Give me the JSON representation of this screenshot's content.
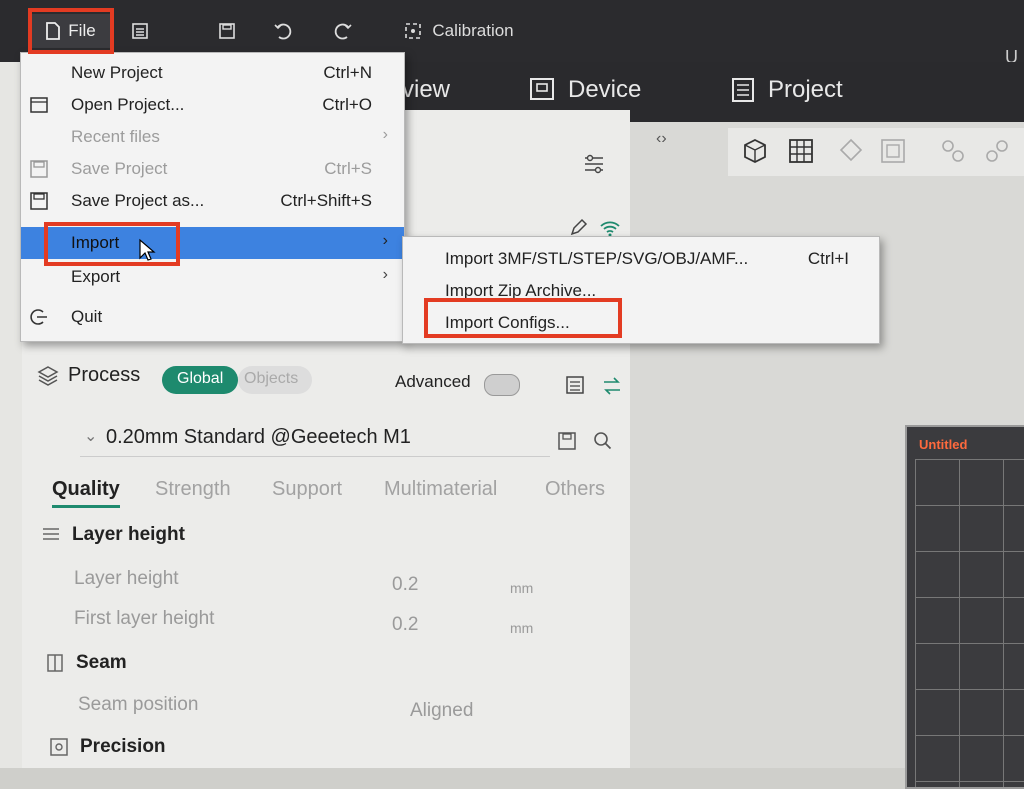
{
  "titlebar": {
    "file_label": "File",
    "calibration_label": "Calibration",
    "user_initial": "U"
  },
  "nav": {
    "tabs": [
      {
        "label": "view",
        "icon": "preview-icon"
      },
      {
        "label": "Device",
        "icon": "device-icon"
      },
      {
        "label": "Project",
        "icon": "project-icon"
      }
    ]
  },
  "file_menu": {
    "items": [
      {
        "label": "New Project",
        "shortcut": "Ctrl+N",
        "enabled": true
      },
      {
        "label": "Open Project...",
        "shortcut": "Ctrl+O",
        "enabled": true
      },
      {
        "label": "Recent files",
        "shortcut": "",
        "enabled": false,
        "submenu": true
      },
      {
        "label": "Save Project",
        "shortcut": "Ctrl+S",
        "enabled": false
      },
      {
        "label": "Save Project as...",
        "shortcut": "Ctrl+Shift+S",
        "enabled": true
      },
      {
        "label": "Import",
        "shortcut": "",
        "enabled": true,
        "submenu": true,
        "highlighted": true
      },
      {
        "label": "Export",
        "shortcut": "",
        "enabled": true,
        "submenu": true
      },
      {
        "label": "Quit",
        "shortcut": "",
        "enabled": true
      }
    ]
  },
  "import_submenu": {
    "items": [
      {
        "label": "Import 3MF/STL/STEP/SVG/OBJ/AMF...",
        "shortcut": "Ctrl+I"
      },
      {
        "label": "Import Zip Archive...",
        "shortcut": ""
      },
      {
        "label": "Import Configs...",
        "shortcut": ""
      }
    ]
  },
  "process": {
    "title": "Process",
    "toggle_global": "Global",
    "toggle_objects": "Objects",
    "advanced_label": "Advanced",
    "preset_name": "0.20mm Standard @Geeetech M1",
    "tabs": [
      "Quality",
      "Strength",
      "Support",
      "Multimaterial",
      "Others"
    ],
    "active_tab": "Quality"
  },
  "settings": {
    "layer_height_section": "Layer height",
    "layer_height_label": "Layer height",
    "layer_height_value": "0.2",
    "layer_height_unit": "mm",
    "first_layer_height_label": "First layer height",
    "first_layer_height_value": "0.2",
    "first_layer_height_unit": "mm",
    "seam_section": "Seam",
    "seam_position_label": "Seam position",
    "seam_position_value": "Aligned",
    "precision_section": "Precision"
  },
  "plate": {
    "label": "Untitled"
  },
  "colors": {
    "accent_green": "#1e8a6e",
    "menu_highlight": "#3d82e0",
    "annotation_red": "#e33b22",
    "plate_label": "#ff6a3d"
  }
}
